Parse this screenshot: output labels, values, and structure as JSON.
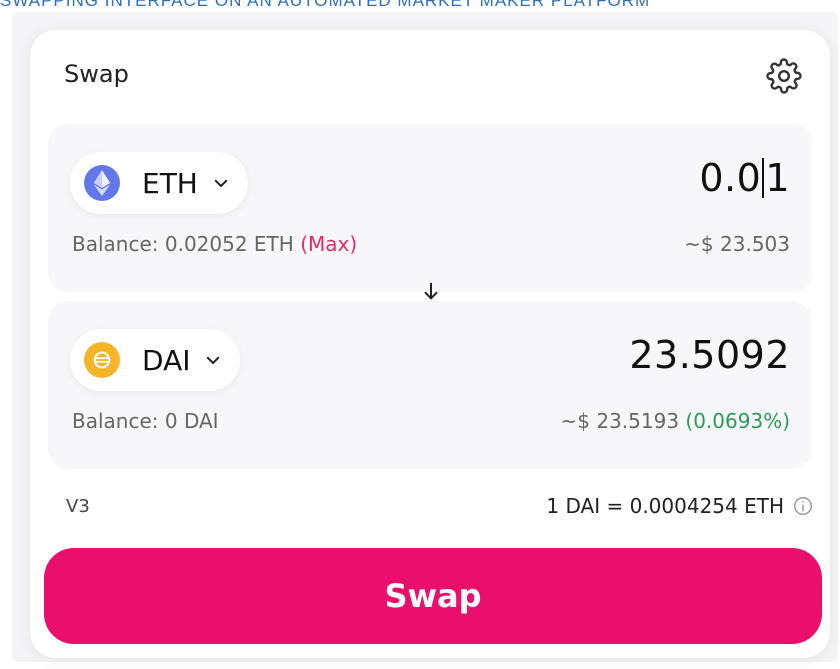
{
  "caption": "SWAPPING INTERFACE ON AN AUTOMATED MARKET MAKER PLATFORM",
  "header": {
    "title": "Swap"
  },
  "from": {
    "token": "ETH",
    "amount_before_caret": "0.0",
    "amount_after_caret": "1",
    "balance_label": "Balance: 0.02052 ETH",
    "max_label": "(Max)",
    "usd_value": "~$ 23.503"
  },
  "to": {
    "token": "DAI",
    "amount": "23.5092",
    "balance_label": "Balance: 0 DAI",
    "usd_value": "~$ 23.5193",
    "price_impact": "(0.0693%)"
  },
  "footer": {
    "version": "V3",
    "rate": "1 DAI = 0.0004254 ETH"
  },
  "swap_button": {
    "label": "Swap"
  },
  "colors": {
    "accent": "#ea0f6d",
    "max": "#e8276b",
    "positive": "#2a9a5c",
    "eth_logo": "#6277e8",
    "dai_logo": "#f5b52a"
  },
  "icons": {
    "settings": "gear-icon",
    "direction": "arrow-down-icon",
    "dropdown": "chevron-down-icon",
    "info": "info-icon"
  }
}
